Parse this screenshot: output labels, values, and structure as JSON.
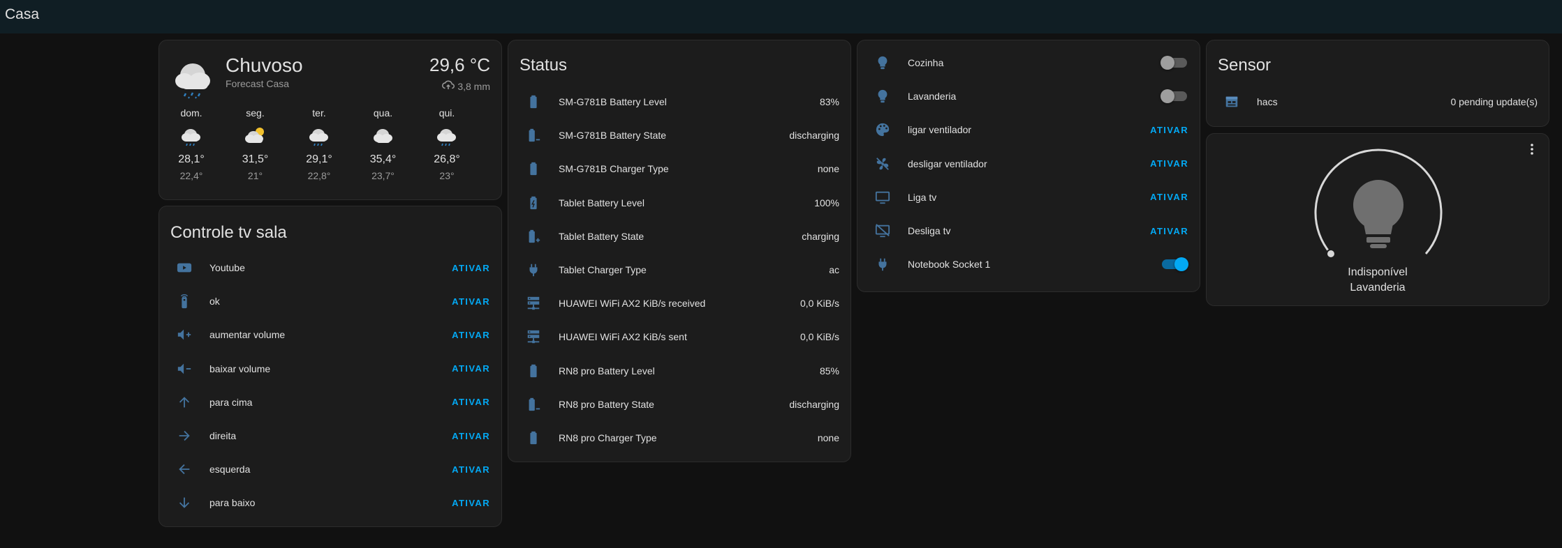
{
  "app": {
    "title": "Casa"
  },
  "colors": {
    "accent": "#03a9f4",
    "icon": "#44739e",
    "card": "#1c1c1c",
    "header": "#101e24"
  },
  "weather": {
    "condition": "Chuvoso",
    "name": "Forecast Casa",
    "temperature": "29,6 °C",
    "precipitation": "3,8 mm",
    "forecast": [
      {
        "day": "dom.",
        "high": "28,1°",
        "low": "22,4°",
        "icon": "rainy"
      },
      {
        "day": "seg.",
        "high": "31,5°",
        "low": "21°",
        "icon": "partly-cloudy"
      },
      {
        "day": "ter.",
        "high": "29,1°",
        "low": "22,8°",
        "icon": "rainy"
      },
      {
        "day": "qua.",
        "high": "35,4°",
        "low": "23,7°",
        "icon": "cloudy"
      },
      {
        "day": "qui.",
        "high": "26,8°",
        "low": "23°",
        "icon": "rainy"
      }
    ]
  },
  "tv_card": {
    "title": "Controle tv sala",
    "items": [
      {
        "label": "Youtube",
        "action": "ATIVAR",
        "icon": "youtube-icon"
      },
      {
        "label": "ok",
        "action": "ATIVAR",
        "icon": "remote-icon"
      },
      {
        "label": "aumentar volume",
        "action": "ATIVAR",
        "icon": "volume-plus-icon"
      },
      {
        "label": "baixar volume",
        "action": "ATIVAR",
        "icon": "volume-minus-icon"
      },
      {
        "label": "para cima",
        "action": "ATIVAR",
        "icon": "arrow-up-icon"
      },
      {
        "label": "direita",
        "action": "ATIVAR",
        "icon": "arrow-right-icon"
      },
      {
        "label": "esquerda",
        "action": "ATIVAR",
        "icon": "arrow-left-icon"
      },
      {
        "label": "para baixo",
        "action": "ATIVAR",
        "icon": "arrow-down-icon"
      }
    ]
  },
  "status_card": {
    "title": "Status",
    "items": [
      {
        "label": "SM-G781B Battery Level",
        "value": "83%",
        "icon": "battery-icon"
      },
      {
        "label": "SM-G781B Battery State",
        "value": "discharging",
        "icon": "battery-minus-icon"
      },
      {
        "label": "SM-G781B Charger Type",
        "value": "none",
        "icon": "battery-icon"
      },
      {
        "label": "Tablet Battery Level",
        "value": "100%",
        "icon": "battery-charging-icon"
      },
      {
        "label": "Tablet Battery State",
        "value": "charging",
        "icon": "battery-plus-icon"
      },
      {
        "label": "Tablet Charger Type",
        "value": "ac",
        "icon": "power-plug-icon"
      },
      {
        "label": "HUAWEI WiFi AX2 KiB/s received",
        "value": "0,0 KiB/s",
        "icon": "server-network-icon"
      },
      {
        "label": "HUAWEI WiFi AX2 KiB/s sent",
        "value": "0,0 KiB/s",
        "icon": "server-network-icon"
      },
      {
        "label": "RN8 pro Battery Level",
        "value": "85%",
        "icon": "battery-icon"
      },
      {
        "label": "RN8 pro Battery State",
        "value": "discharging",
        "icon": "battery-minus-icon"
      },
      {
        "label": "RN8 pro Charger Type",
        "value": "none",
        "icon": "battery-icon"
      }
    ]
  },
  "control_card": {
    "items": [
      {
        "label": "Cozinha",
        "type": "toggle",
        "state": "off",
        "icon": "lightbulb-icon"
      },
      {
        "label": "Lavanderia",
        "type": "toggle",
        "state": "off",
        "icon": "lightbulb-icon"
      },
      {
        "label": "ligar ventilador",
        "type": "button",
        "action": "ATIVAR",
        "icon": "palette-icon"
      },
      {
        "label": "desligar ventilador",
        "type": "button",
        "action": "ATIVAR",
        "icon": "fan-off-icon"
      },
      {
        "label": "Liga tv",
        "type": "button",
        "action": "ATIVAR",
        "icon": "television-icon"
      },
      {
        "label": "Desliga tv",
        "type": "button",
        "action": "ATIVAR",
        "icon": "television-off-icon"
      },
      {
        "label": "Notebook Socket 1",
        "type": "toggle",
        "state": "on",
        "icon": "power-plug-icon"
      }
    ]
  },
  "sensor_card": {
    "title": "Sensor",
    "items": [
      {
        "label": "hacs",
        "value": "0 pending update(s)",
        "icon": "hacs-icon"
      }
    ]
  },
  "light_card": {
    "state": "Indisponível",
    "name": "Lavanderia",
    "brightness": 0
  }
}
